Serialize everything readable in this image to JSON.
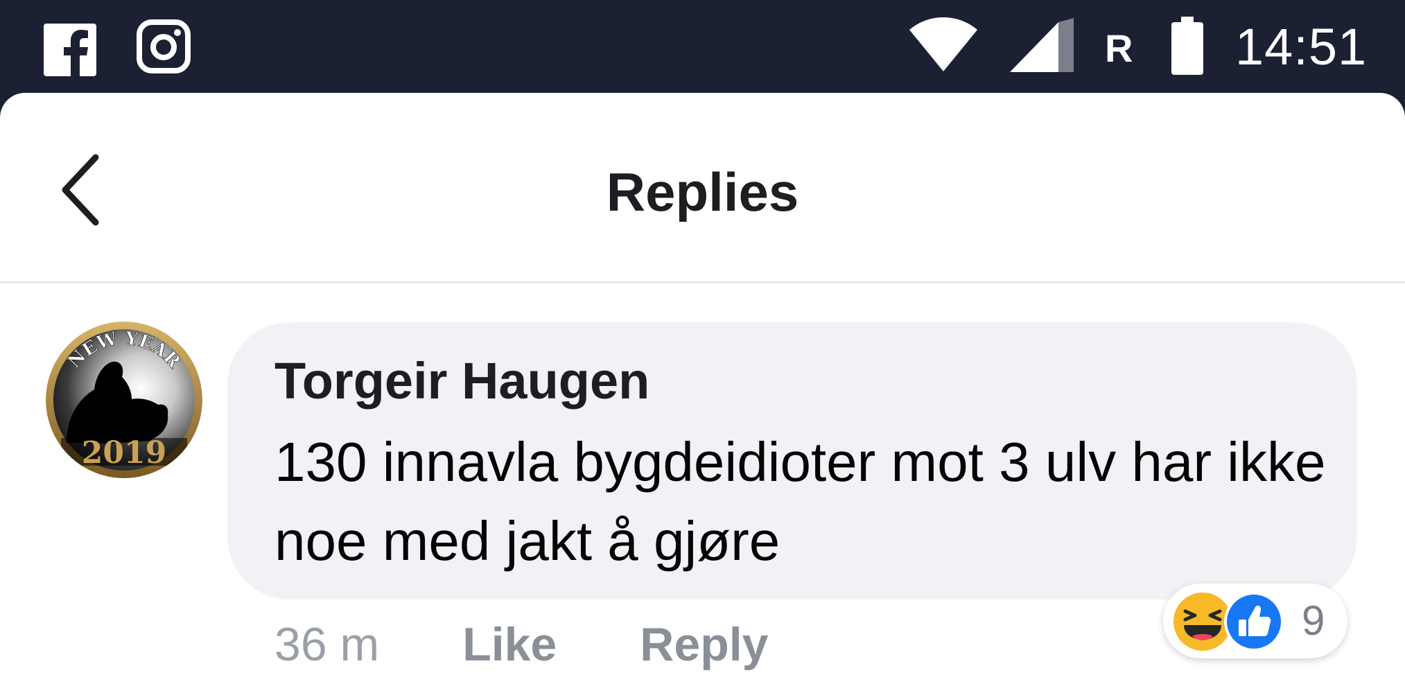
{
  "status_bar": {
    "left_icons": [
      "facebook-icon",
      "instagram-icon"
    ],
    "right_icons": [
      "wifi-icon",
      "signal-icon",
      "battery-icon"
    ],
    "roaming_label": "R",
    "time": "14:51"
  },
  "header": {
    "title": "Replies",
    "back_icon": "chevron-left-icon"
  },
  "comment": {
    "author": "Torgeir Haugen",
    "text": "130 innavla bygdeidioter mot 3 ulv har ikke noe med jakt å gjøre",
    "avatar": {
      "icon": "new-year-avatar",
      "badge_top": "NEW YEAR",
      "badge_year": "2019"
    },
    "timestamp": "36 m",
    "like_label": "Like",
    "reply_label": "Reply",
    "reactions": {
      "types": [
        "haha",
        "like"
      ],
      "count": "9"
    }
  },
  "colors": {
    "status_bar_bg": "#1c2033",
    "bubble_bg": "#f0f2f5",
    "like_blue": "#1877f2",
    "haha_yellow": "#f7b928",
    "muted_text": "#8a8f98"
  }
}
